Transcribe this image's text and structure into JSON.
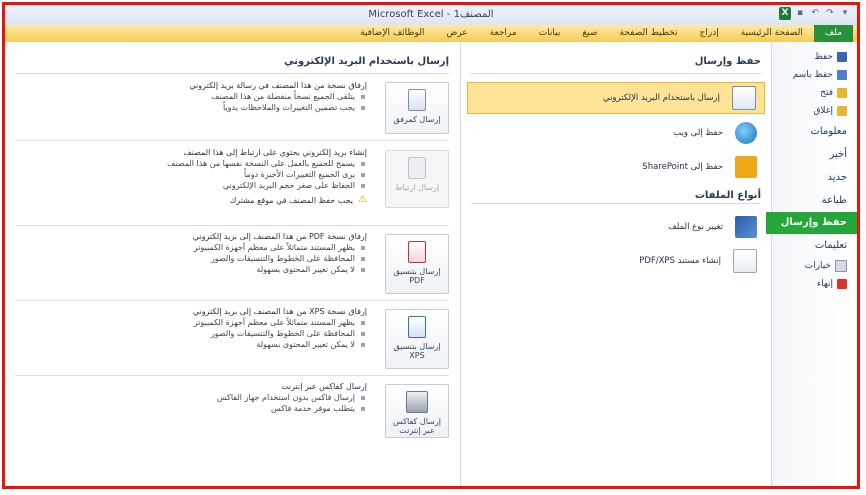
{
  "window": {
    "title": "Microsoft Excel - المصنف1",
    "qat_icons": [
      "excel-icon",
      "save-icon",
      "undo-icon",
      "redo-icon",
      "customize-icon"
    ]
  },
  "ribbon": {
    "tabs": [
      "ملف",
      "الصفحة الرئيسية",
      "إدراج",
      "تخطيط الصفحة",
      "صيغ",
      "بيانات",
      "مراجعة",
      "عرض",
      "الوظائف الإضافية"
    ]
  },
  "nav": {
    "items": [
      "حفظ",
      "حفظ باسم",
      "فتح",
      "إغلاق"
    ],
    "heads": [
      "معلومات",
      "أخير",
      "جديد",
      "طباعة"
    ],
    "active": "حفظ وإرسال",
    "help": "تعليمات",
    "bottom": [
      "خيارات",
      "إنهاء"
    ]
  },
  "middle": {
    "section1": "حفظ وإرسال",
    "options1": [
      "إرسال باستخدام البريد الإلكتروني",
      "حفظ إلى ويب",
      "حفظ إلى SharePoint"
    ],
    "section2": "أنواع الملفات",
    "options2": [
      "تغيير نوع الملف",
      "إنشاء مستند PDF/XPS"
    ]
  },
  "right": {
    "title": "إرسال باستخدام البريد الإلكتروني",
    "blocks": [
      {
        "button": "إرسال كمرفق",
        "head": "إرفاق نسخة من هذا المصنف في رسالة بريد إلكتروني",
        "bullets": [
          "يتلقى الجميع نسخاً منفصلة من هذا المصنف",
          "يجب تضمين التغييرات والملاحظات يدوياً"
        ]
      },
      {
        "button": "إرسال ارتباط",
        "head": "إنشاء بريد إلكتروني يحتوي على ارتباط إلى هذا المصنف",
        "bullets": [
          "يسمح للجميع بالعمل على النسخة نفسها من هذا المصنف",
          "يرى الجميع التغييرات الأخيرة دوماً",
          "الحفاظ على صغر حجم البريد الإلكتروني"
        ],
        "warning": "يجب حفظ المصنف في موقع مشترك"
      },
      {
        "button": "إرسال بتنسيق PDF",
        "head": "إرفاق نسخة PDF من هذا المصنف إلى بريد إلكتروني",
        "bullets": [
          "يظهر المستند متماثلاً على معظم أجهزة الكمبيوتر",
          "المحافظة على الخطوط والتنسيقات والصور",
          "لا يمكن تغيير المحتوى بسهولة"
        ]
      },
      {
        "button": "إرسال بتنسيق XPS",
        "head": "إرفاق نسخة XPS من هذا المصنف إلى بريد إلكتروني",
        "bullets": [
          "يظهر المستند متماثلاً على معظم أجهزة الكمبيوتر",
          "المحافظة على الخطوط والتنسيقات والصور",
          "لا يمكن تغيير المحتوى بسهولة"
        ]
      },
      {
        "button": "إرسال كفاكس عبر إنترنت",
        "head": "إرسال كفاكس عبر إنترنت",
        "bullets": [
          "إرسال فاكس بدون استخدام جهاز الفاكس",
          "يتطلب موفر خدمة فاكس"
        ]
      }
    ]
  },
  "colors": {
    "frame": "#e8140e",
    "ribbon": "#f7cc54",
    "file_tab": "#27923a",
    "nav_active": "#24a63a",
    "selected_option": "#fde396"
  }
}
